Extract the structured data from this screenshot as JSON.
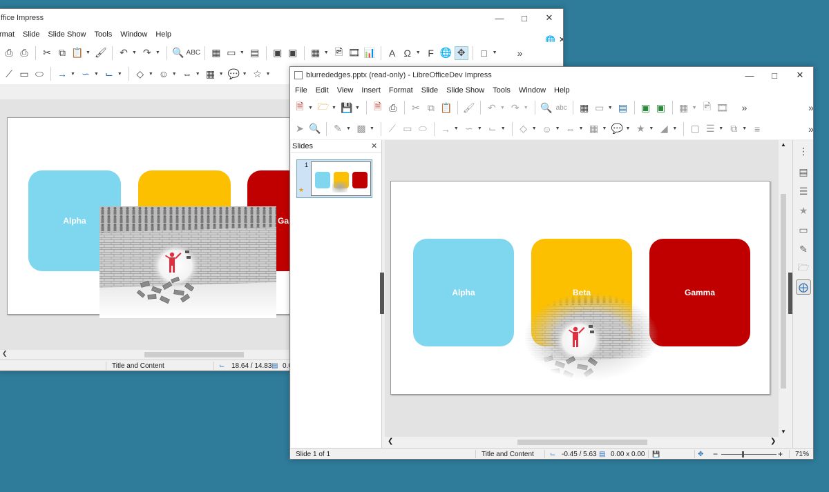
{
  "back_window": {
    "title": "ffice Impress",
    "menus": [
      "rmat",
      "Slide",
      "Slide Show",
      "Tools",
      "Window",
      "Help"
    ],
    "status": {
      "layout": "Title and Content",
      "position": "18.64 / 14.83",
      "size": "0.0"
    },
    "boxes": [
      "Alpha",
      "",
      "Ga"
    ]
  },
  "front_window": {
    "title": "blurrededges.pptx (read-only) - LibreOfficeDev Impress",
    "menus": [
      "File",
      "Edit",
      "View",
      "Insert",
      "Format",
      "Slide",
      "Slide Show",
      "Tools",
      "Window",
      "Help"
    ],
    "slides_panel": {
      "title": "Slides",
      "slide_number": "1"
    },
    "slide_boxes": [
      "Alpha",
      "Beta",
      "Gamma"
    ],
    "status": {
      "slide": "Slide 1 of 1",
      "layout": "Title and Content",
      "position": "-0.45 / 5.63",
      "size": "0.00 x 0.00",
      "zoom": "71%"
    }
  },
  "colors": {
    "alpha": "#7fd6ef",
    "beta": "#fcc000",
    "gamma": "#c00000",
    "desktop": "#2e7b9a"
  },
  "icons": [
    "cut-icon",
    "copy-icon",
    "paste-icon",
    "undo-icon",
    "redo-icon",
    "spellcheck-icon",
    "table-icon",
    "image-icon",
    "chart-icon",
    "text-icon",
    "special-char-icon",
    "hyperlink-icon",
    "shapes-icon",
    "print-icon",
    "export-pdf-icon",
    "save-icon",
    "open-icon",
    "new-icon",
    "select-icon",
    "zoom-icon",
    "line-icon",
    "rectangle-icon",
    "ellipse-icon",
    "arrow-icon",
    "curve-icon",
    "connector-icon",
    "basic-shapes-icon",
    "smiley-icon",
    "block-arrows-icon",
    "flowchart-icon",
    "callout-icon",
    "star-icon",
    "3d-icon",
    "properties-icon",
    "styles-icon",
    "gallery-icon",
    "navigator-icon"
  ]
}
